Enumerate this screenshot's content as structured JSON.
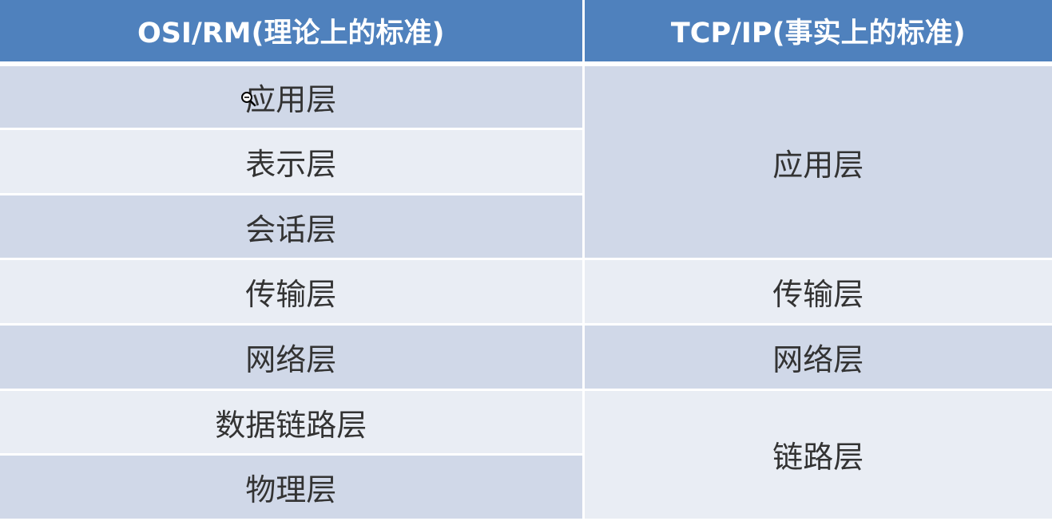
{
  "table": {
    "headers": {
      "osi": "OSI/RM(理论上的标准)",
      "tcpip": "TCP/IP(事实上的标准)"
    },
    "osi_layers": [
      "应用层",
      "表示层",
      "会话层",
      "传输层",
      "网络层",
      "数据链路层",
      "物理层"
    ],
    "tcpip_layers": [
      "应用层",
      "传输层",
      "网络层",
      "链路层"
    ]
  },
  "icons": {
    "cursor": "magnifier-cursor-icon"
  },
  "colors": {
    "header_bg": "#4f81bd",
    "row_dark": "#d0d8e8",
    "row_light": "#e9edf4",
    "text": "#333333"
  }
}
